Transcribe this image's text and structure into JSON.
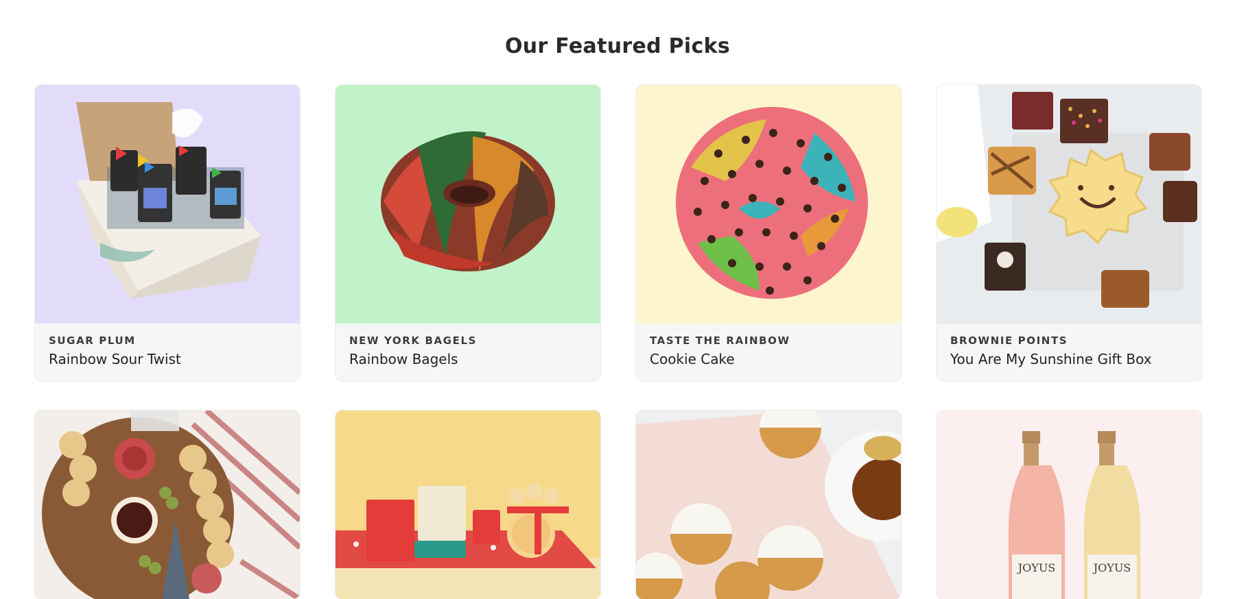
{
  "section": {
    "title": "Our Featured Picks"
  },
  "products": [
    {
      "vendor": "SUGAR PLUM",
      "name": "Rainbow Sour Twist",
      "bg": "#e2dcfa",
      "icon": "gift-box-image"
    },
    {
      "vendor": "NEW YORK BAGELS",
      "name": "Rainbow Bagels",
      "bg": "#c1f2c9",
      "icon": "bagel-image"
    },
    {
      "vendor": "TASTE THE RAINBOW",
      "name": "Cookie Cake",
      "bg": "#fdf5cd",
      "icon": "cookie-cake-image"
    },
    {
      "vendor": "BROWNIE POINTS",
      "name": "You Are My Sunshine Gift Box",
      "bg": "#eef0f1",
      "icon": "brownie-box-image"
    }
  ],
  "products_row2": [
    {
      "icon": "charcuterie-image",
      "bg": "#efe9e3"
    },
    {
      "icon": "biscuit-set-image",
      "bg": "#f6d98a"
    },
    {
      "icon": "ginger-cookies-image",
      "bg": "#f4e4df"
    },
    {
      "icon": "sparkling-wine-image",
      "bg": "#fcefef",
      "labels": [
        "JOYUS",
        "JOYUS"
      ]
    }
  ]
}
